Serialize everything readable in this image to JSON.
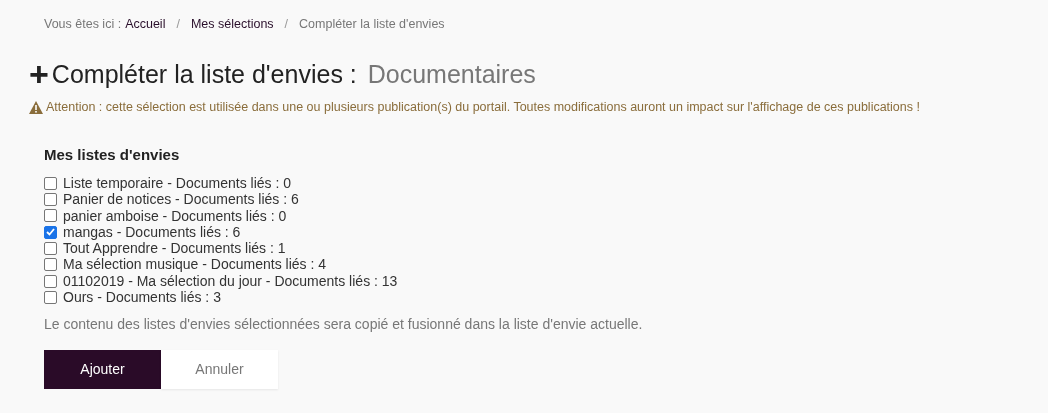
{
  "breadcrumb": {
    "prefix": "Vous êtes ici :",
    "separator": "/",
    "items": [
      {
        "label": "Accueil",
        "kind": "link"
      },
      {
        "label": "Mes sélections",
        "kind": "link"
      },
      {
        "label": "Compléter la liste d'envies",
        "kind": "current"
      }
    ]
  },
  "title": {
    "icon": "+",
    "text": "Compléter la liste d'envies :",
    "subject": "Documentaires"
  },
  "warning": "Attention : cette sélection est utilisée dans une ou plusieurs publication(s) du portail. Toutes modifications auront un impact sur l'affichage de ces publications !",
  "lists": {
    "heading": "Mes listes d'envies",
    "items": [
      {
        "label": "Liste temporaire - Documents liés : 0",
        "checked": false
      },
      {
        "label": "Panier de notices - Documents liés : 6",
        "checked": false
      },
      {
        "label": "panier amboise - Documents liés : 0",
        "checked": false
      },
      {
        "label": "mangas - Documents liés : 6",
        "checked": true
      },
      {
        "label": "Tout Apprendre - Documents liés : 1",
        "checked": false
      },
      {
        "label": "Ma sélection musique - Documents liés : 4",
        "checked": false
      },
      {
        "label": "01102019 - Ma sélection du jour - Documents liés : 13",
        "checked": false
      },
      {
        "label": "Ours - Documents liés : 3",
        "checked": false
      }
    ],
    "help": "Le contenu des listes d'envies sélectionnées sera copié et fusionné dans la liste d'envie actuelle."
  },
  "buttons": [
    {
      "label": "Ajouter",
      "kind": "primary"
    },
    {
      "label": "Annuler",
      "kind": "secondary"
    }
  ]
}
